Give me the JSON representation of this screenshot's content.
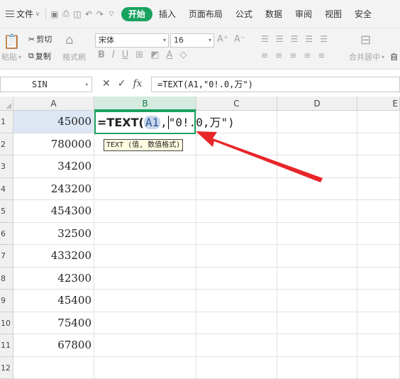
{
  "menubar": {
    "file_label": "文件",
    "tabs": [
      "开始",
      "插入",
      "页面布局",
      "公式",
      "数据",
      "审阅",
      "视图",
      "安全"
    ],
    "active_tab": "开始"
  },
  "ribbon": {
    "paste_label": "粘贴",
    "cut_label": "剪切",
    "copy_label": "复制",
    "format_painter_label": "格式刷",
    "font_name": "宋体",
    "font_size": "16",
    "merge_label": "合并居中",
    "auto_label": "自"
  },
  "formula_bar": {
    "name_box": "SIN",
    "formula": "=TEXT(A1,\"0!.0,万\")"
  },
  "columns": [
    "A",
    "B",
    "C",
    "D",
    "E"
  ],
  "rows": [
    "1",
    "2",
    "3",
    "4",
    "5",
    "6",
    "7",
    "8",
    "9",
    "10",
    "11",
    "12"
  ],
  "column_a_values": [
    "45000",
    "780000",
    "34200",
    "243200",
    "454300",
    "32500",
    "433200",
    "42300",
    "45400",
    "75400",
    "67800",
    ""
  ],
  "editor": {
    "prefix": "=TEXT(",
    "ref": "A1",
    "comma": ",",
    "suffix": "\"0!.0,万\")"
  },
  "tooltip": "TEXT (值, 数值格式)",
  "colors": {
    "accent": "#1aa260",
    "arrow": "#e8262a"
  }
}
